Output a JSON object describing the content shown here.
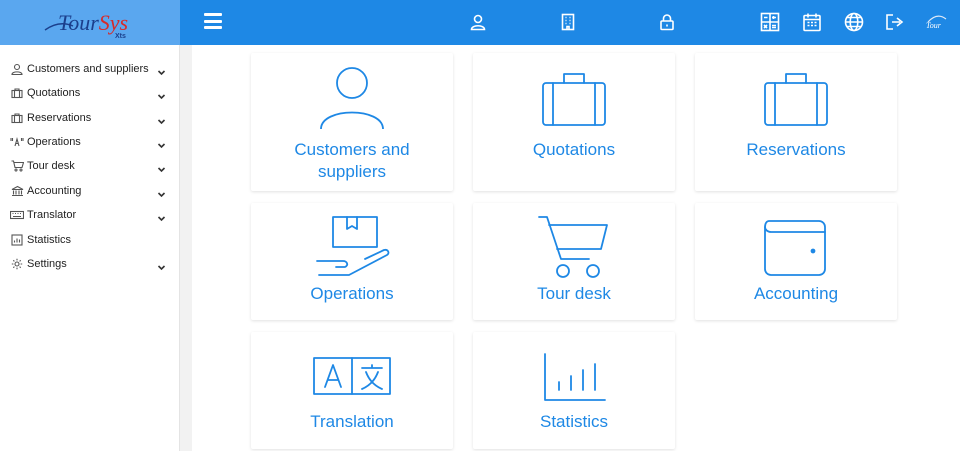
{
  "header": {
    "logo_text_a": "Tour",
    "logo_text_b": "Sys",
    "logo_sub": "Xts",
    "mini_logo_text": "Tour",
    "accent": "#1e88e5",
    "icons": [
      "menu-icon",
      "user-icon",
      "building-icon",
      "lock-icon",
      "calculator-icon",
      "calendar-icon",
      "globe-icon",
      "logout-icon"
    ]
  },
  "sidebar": {
    "items": [
      {
        "label": "Customers and suppliers",
        "icon": "user-icon",
        "expandable": true
      },
      {
        "label": "Quotations",
        "icon": "briefcase-icon",
        "expandable": true
      },
      {
        "label": "Reservations",
        "icon": "briefcase-icon",
        "expandable": true
      },
      {
        "label": "Operations",
        "icon": "quote-a-icon",
        "expandable": true
      },
      {
        "label": "Tour desk",
        "icon": "cart-icon",
        "expandable": true
      },
      {
        "label": "Accounting",
        "icon": "bank-icon",
        "expandable": true
      },
      {
        "label": "Translator",
        "icon": "keyboard-icon",
        "expandable": true
      },
      {
        "label": "Statistics",
        "icon": "chart-icon",
        "expandable": false
      },
      {
        "label": "Settings",
        "icon": "gear-icon",
        "expandable": true
      }
    ]
  },
  "tiles": [
    {
      "label_line1": "Customers and",
      "label_line2": "suppliers",
      "icon": "user-icon"
    },
    {
      "label_line1": "Quotations",
      "icon": "briefcase-icon"
    },
    {
      "label_line1": "Reservations",
      "icon": "briefcase-icon"
    },
    {
      "label_line1": "Operations",
      "icon": "hand-box-icon"
    },
    {
      "label_line1": "Tour desk",
      "icon": "cart-icon"
    },
    {
      "label_line1": "Accounting",
      "icon": "wallet-icon"
    },
    {
      "label_line1": "Translation",
      "icon": "translate-icon"
    },
    {
      "label_line1": "Statistics",
      "icon": "bar-chart-icon"
    }
  ]
}
